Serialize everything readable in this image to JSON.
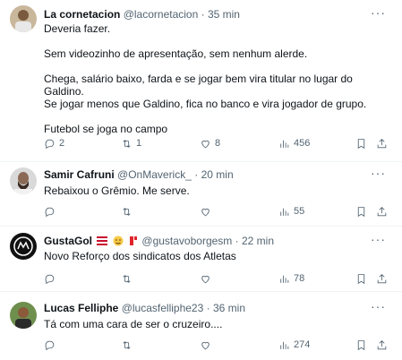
{
  "tweets": [
    {
      "name": "La cornetacion",
      "handle": "@lacornetacion",
      "time": "35 min",
      "lines": [
        "Deveria fazer.",
        "",
        "Sem videozinho de apresentação, sem nenhum alerde.",
        "",
        "Chega, salário baixo, farda e se jogar bem vira titular no lugar do Galdino.",
        "Se jogar menos que Galdino, fica no banco e vira jogador de grupo.",
        "",
        "Futebol se joga no campo"
      ],
      "replies": "2",
      "retweets": "1",
      "likes": "8",
      "views": "456"
    },
    {
      "name": "Samir Cafruni",
      "handle": "@OnMaverick_",
      "time": "20 min",
      "lines": [
        "Rebaixou o Grêmio. Me serve."
      ],
      "replies": "",
      "retweets": "",
      "likes": "",
      "views": "55"
    },
    {
      "name": "GustaGol",
      "handle": "@gustavoborgesm",
      "time": "22 min",
      "lines": [
        "Novo Reforço dos sindicatos dos Atletas"
      ],
      "replies": "",
      "retweets": "",
      "likes": "",
      "views": "78"
    },
    {
      "name": "Lucas Felliphe",
      "handle": "@lucasfelliphe23",
      "time": "36 min",
      "lines": [
        "Tá com uma cara de ser o cruzeiro...."
      ],
      "replies": "",
      "retweets": "",
      "likes": "",
      "views": "274"
    }
  ],
  "separator": "·",
  "more_glyph": "···",
  "colors": {
    "text": "#0f1419",
    "muted": "#536471",
    "divider": "#eff3f4"
  },
  "icons": [
    "reply-icon",
    "retweet-icon",
    "like-icon",
    "views-icon",
    "bookmark-icon",
    "share-icon"
  ]
}
